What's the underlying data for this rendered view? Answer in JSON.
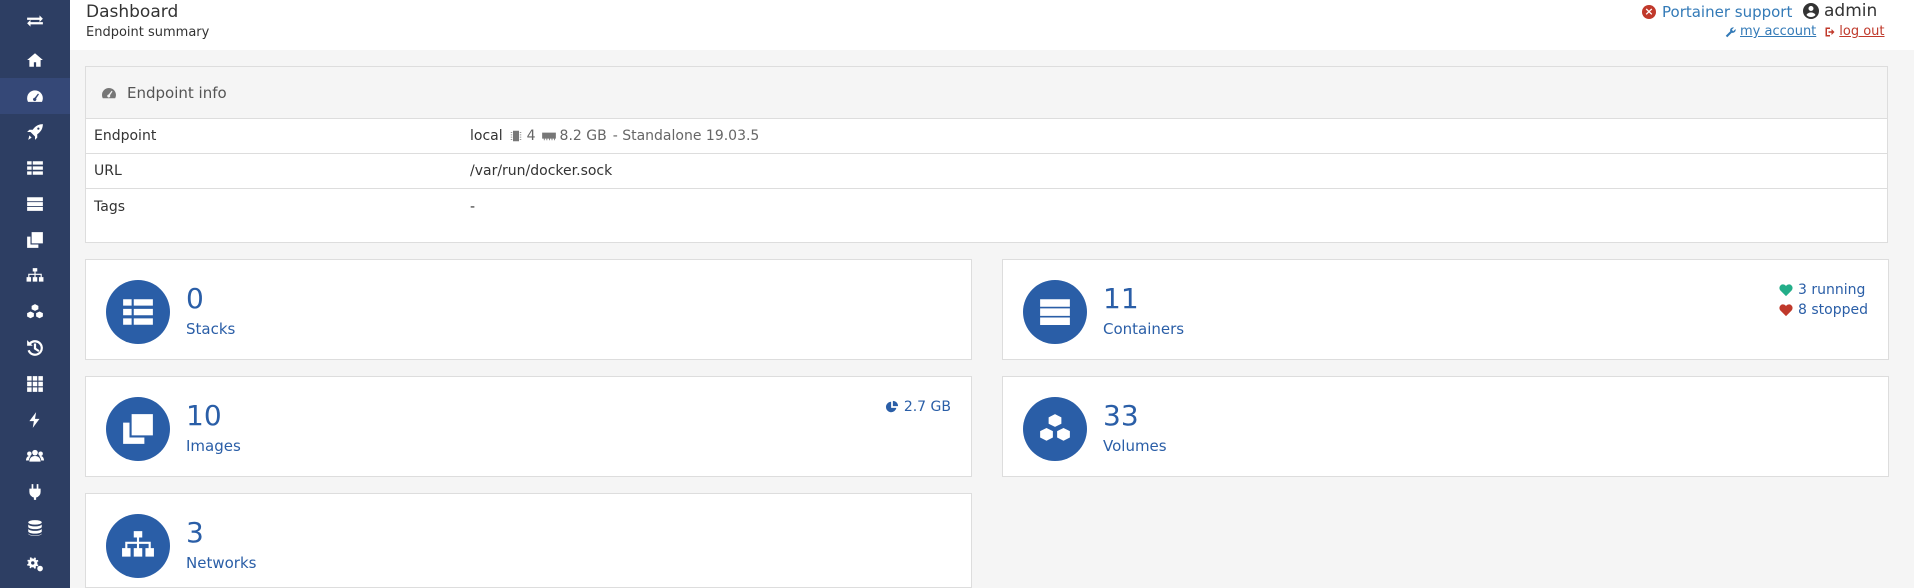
{
  "sidebar": {
    "toggle_icon": "exchange-icon",
    "items": [
      {
        "name": "home",
        "icon": "home-icon"
      },
      {
        "name": "dashboard",
        "icon": "tachometer-icon",
        "active": true
      },
      {
        "name": "app-templates",
        "icon": "rocket-icon"
      },
      {
        "name": "stacks",
        "icon": "th-list-icon"
      },
      {
        "name": "containers",
        "icon": "server-icon"
      },
      {
        "name": "images",
        "icon": "clone-icon"
      },
      {
        "name": "networks",
        "icon": "sitemap-icon"
      },
      {
        "name": "volumes",
        "icon": "cubes-icon"
      },
      {
        "name": "events",
        "icon": "history-icon"
      },
      {
        "name": "host",
        "icon": "th-icon"
      },
      {
        "name": "extensions",
        "icon": "bolt-icon"
      },
      {
        "name": "users",
        "icon": "users-icon"
      },
      {
        "name": "endpoints",
        "icon": "plug-icon"
      },
      {
        "name": "registries",
        "icon": "database-icon"
      },
      {
        "name": "settings",
        "icon": "cogs-icon"
      }
    ]
  },
  "header": {
    "title": "Dashboard",
    "subtitle": "Endpoint summary",
    "support_label": "Portainer support",
    "user": "admin",
    "my_account": "my account",
    "log_out": "log out"
  },
  "endpoint_info": {
    "title": "Endpoint info",
    "rows": {
      "endpoint": {
        "key": "Endpoint",
        "name": "local",
        "cpu": "4",
        "memory": "8.2 GB",
        "mode": "- Standalone 19.03.5"
      },
      "url": {
        "key": "URL",
        "value": "/var/run/docker.sock"
      },
      "tags": {
        "key": "Tags",
        "value": "-"
      }
    }
  },
  "widgets": {
    "stacks": {
      "value": "0",
      "label": "Stacks",
      "icon": "th-list-icon"
    },
    "containers": {
      "value": "11",
      "label": "Containers",
      "icon": "server-icon",
      "running": "3 running",
      "stopped": "8 stopped"
    },
    "images": {
      "value": "10",
      "label": "Images",
      "icon": "clone-icon",
      "size": "2.7 GB"
    },
    "volumes": {
      "value": "33",
      "label": "Volumes",
      "icon": "cubes-icon"
    },
    "networks": {
      "value": "3",
      "label": "Networks",
      "icon": "sitemap-icon"
    }
  },
  "colors": {
    "sidebar": "#2d3e63",
    "accent": "#2a5ea7",
    "running": "#23ae89",
    "stopped": "#c0392b"
  }
}
